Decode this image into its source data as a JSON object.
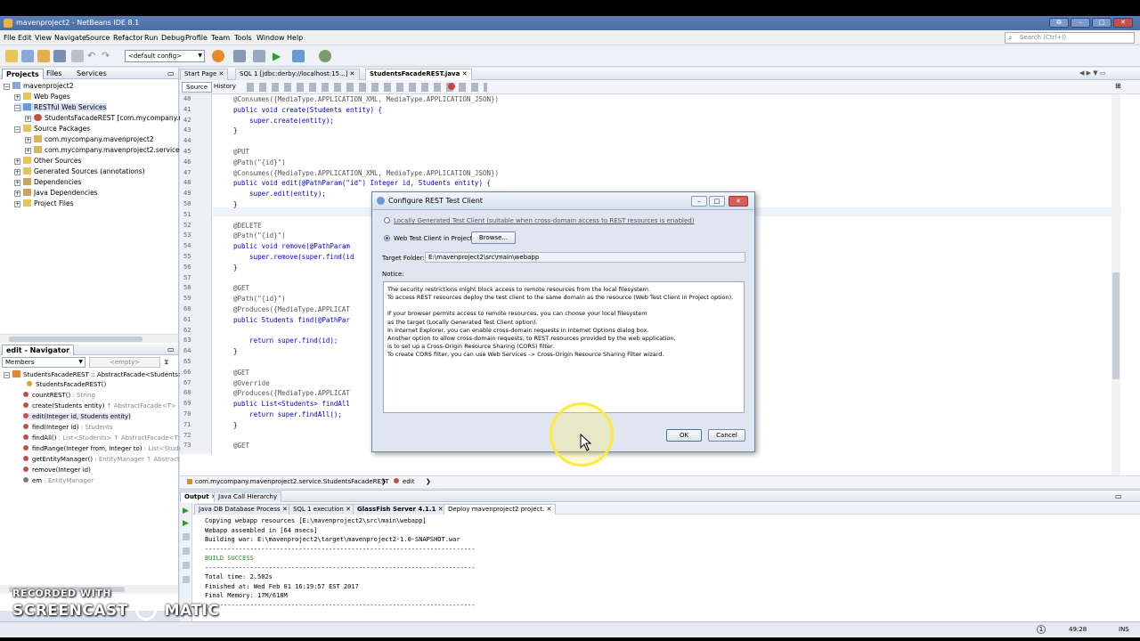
{
  "window": {
    "title": "mavenproject2 - NetBeans IDE 8.1"
  },
  "menubar": {
    "items": [
      "File",
      "Edit",
      "View",
      "Navigate",
      "Source",
      "Refactor",
      "Run",
      "Debug",
      "Profile",
      "Team",
      "Tools",
      "Window",
      "Help"
    ],
    "search_placeholder": "Search (Ctrl+I)"
  },
  "toolbar": {
    "config": "<default config>"
  },
  "projects_panel": {
    "tabs": [
      "Projects",
      "Files",
      "Services"
    ],
    "tree": [
      {
        "label": "mavenproject2",
        "depth": 0
      },
      {
        "label": "Web Pages",
        "depth": 1
      },
      {
        "label": "RESTful Web Services",
        "depth": 1
      },
      {
        "label": "StudentsFacadeREST [com.mycompany.mav",
        "depth": 2
      },
      {
        "label": "Source Packages",
        "depth": 1
      },
      {
        "label": "com.mycompany.mavenproject2",
        "depth": 2
      },
      {
        "label": "com.mycompany.mavenproject2.service",
        "depth": 2
      },
      {
        "label": "Other Sources",
        "depth": 1
      },
      {
        "label": "Generated Sources (annotations)",
        "depth": 1
      },
      {
        "label": "Dependencies",
        "depth": 1
      },
      {
        "label": "Java Dependencies",
        "depth": 1
      },
      {
        "label": "Project Files",
        "depth": 1
      }
    ]
  },
  "navigator_panel": {
    "title": "edit - Navigator",
    "filter": "Members",
    "filter2": "<empty>",
    "root": "StudentsFacadeREST :: AbstractFacade<Students>",
    "members": [
      {
        "name": "StudentsFacadeREST()",
        "type": ""
      },
      {
        "name": "countREST()",
        "type": " : String"
      },
      {
        "name": "create(Students entity)",
        "type": " ↑ AbstractFacade<T>"
      },
      {
        "name": "edit(Integer id, Students entity)",
        "type": ""
      },
      {
        "name": "find(Integer id)",
        "type": " : Students"
      },
      {
        "name": "findAll()",
        "type": " : List<Students> ↑ AbstractFacade<T>"
      },
      {
        "name": "findRange(Integer from, Integer to)",
        "type": " : List<Studen"
      },
      {
        "name": "getEntityManager()",
        "type": " : EntityManager ↑ AbstractFac"
      },
      {
        "name": "remove(Integer id)",
        "type": ""
      },
      {
        "name": "em",
        "type": " : EntityManager"
      }
    ]
  },
  "editor": {
    "tabs": [
      "Start Page",
      "SQL 1 [jdbc:derby://localhost:15...]",
      "StudentsFacadeREST.java"
    ],
    "mode_tabs": [
      "Source",
      "History"
    ],
    "lines": [
      {
        "n": "40",
        "text": "@Consumes({MediaType.APPLICATION_XML, MediaType.APPLICATION_JSON})"
      },
      {
        "n": "41",
        "text": "public void create(Students entity) {"
      },
      {
        "n": "42",
        "text": "    super.create(entity);"
      },
      {
        "n": "43",
        "text": "}"
      },
      {
        "n": "44",
        "text": ""
      },
      {
        "n": "45",
        "text": "@PUT"
      },
      {
        "n": "46",
        "text": "@Path(\"{id}\")"
      },
      {
        "n": "47",
        "text": "@Consumes({MediaType.APPLICATION_XML, MediaType.APPLICATION_JSON})"
      },
      {
        "n": "48",
        "text": "public void edit(@PathParam(\"id\") Integer id, Students entity) {"
      },
      {
        "n": "49",
        "text": "    super.edit(entity);"
      },
      {
        "n": "50",
        "text": "}"
      },
      {
        "n": "51",
        "text": ""
      },
      {
        "n": "52",
        "text": "@DELETE"
      },
      {
        "n": "53",
        "text": "@Path(\"{id}\")"
      },
      {
        "n": "54",
        "text": "public void remove(@PathParam"
      },
      {
        "n": "55",
        "text": "    super.remove(super.find(id"
      },
      {
        "n": "56",
        "text": "}"
      },
      {
        "n": "57",
        "text": ""
      },
      {
        "n": "58",
        "text": "@GET"
      },
      {
        "n": "59",
        "text": "@Path(\"{id}\")"
      },
      {
        "n": "60",
        "text": "@Produces({MediaType.APPLICAT"
      },
      {
        "n": "61",
        "text": "public Students find(@PathPar"
      },
      {
        "n": "62",
        "text": ""
      },
      {
        "n": "63",
        "text": "    return super.find(id);"
      },
      {
        "n": "64",
        "text": "}"
      },
      {
        "n": "65",
        "text": ""
      },
      {
        "n": "66",
        "text": "@GET"
      },
      {
        "n": "67",
        "text": "@Override"
      },
      {
        "n": "68",
        "text": "@Produces({MediaType.APPLICAT"
      },
      {
        "n": "69",
        "text": "public List<Students> findAll"
      },
      {
        "n": "70",
        "text": "    return super.findAll();"
      },
      {
        "n": "71",
        "text": "}"
      },
      {
        "n": "72",
        "text": ""
      },
      {
        "n": "73",
        "text": "@GET"
      }
    ],
    "breadcrumb": [
      "com.mycompany.mavenproject2.service.StudentsFacadeREST",
      "edit"
    ]
  },
  "output_panel": {
    "tabs": [
      "Output",
      "Java Call Hierarchy"
    ],
    "subtabs": [
      "Java DB Database Process",
      "SQL 1 execution",
      "GlassFish Server 4.1.1",
      "Deploy mavenproject2 project."
    ],
    "lines": [
      "Copying webapp resources [E:\\mavenproject2\\src\\main\\webapp]",
      "Webapp assembled in [64 msecs]",
      "Building war: E:\\mavenproject2\\target\\mavenproject2-1.0-SNAPSHOT.war",
      "------------------------------------------------------------------------",
      "BUILD SUCCESS",
      "------------------------------------------------------------------------",
      "Total time: 2.502s",
      "Finished at: Wed Feb 01 16:19:57 EST 2017",
      "Final Memory: 17M/618M",
      "------------------------------------------------------------------------"
    ]
  },
  "dialog": {
    "title": "Configure REST Test Client",
    "option_local": "Locally Generated Test Client (suitable when cross-domain access to REST resources is enabled)",
    "option_web": "Web Test Client in Project",
    "browse": "Browse...",
    "target_label": "Target Folder:",
    "target_value": "E:\\mavenproject2\\src\\main\\webapp",
    "notice_label": "Notice:",
    "notice_lines": [
      "The security restrictions might block access to remote resources from the local filesystem.",
      "To access REST resources deploy the test client to the same domain as the resource (Web Test Client in Project option).",
      "",
      "If your browser permits access to remote resources, you can choose your local filesystem",
      "as the target (Locally Generated Test Client option).",
      "In Internet Explorer, you can enable cross-domain requests in Internet Options dialog box.",
      "Another option to allow cross-domain requests, to REST resources provided by the web application,",
      "is to set up a Cross-Origin Resource Sharing (CORS) filter.",
      "To create CORS filter, you can use Web Services -> Cross-Origin Resource Sharing Filter wizard."
    ],
    "ok": "OK",
    "cancel": "Cancel"
  },
  "statusbar": {
    "position": "49:28",
    "mode": "INS"
  },
  "watermark": {
    "line1": "RECORDED WITH",
    "line2": "SCREENCAST",
    "line3": "MATIC"
  },
  "colors": {
    "accent": "#4a6ea5",
    "keyword": "#0000e6",
    "string": "#c46a00",
    "success": "#2a8a2a"
  }
}
